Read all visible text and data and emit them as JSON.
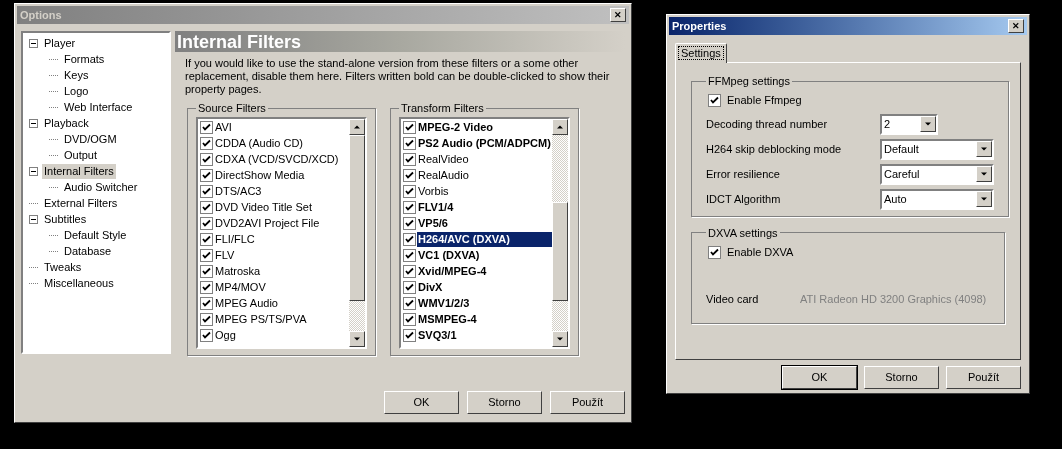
{
  "options_window": {
    "title": "Options",
    "close": "✕",
    "tree": [
      {
        "label": "Player",
        "expanded": true,
        "selected": false,
        "children": [
          {
            "label": "Formats",
            "selected": false
          },
          {
            "label": "Keys",
            "selected": false
          },
          {
            "label": "Logo",
            "selected": false
          },
          {
            "label": "Web Interface",
            "selected": false
          }
        ]
      },
      {
        "label": "Playback",
        "expanded": true,
        "selected": false,
        "children": [
          {
            "label": "DVD/OGM",
            "selected": false
          },
          {
            "label": "Output",
            "selected": false
          }
        ]
      },
      {
        "label": "Internal Filters",
        "expanded": true,
        "selected": true,
        "children": [
          {
            "label": "Audio Switcher",
            "selected": false
          }
        ]
      },
      {
        "label": "External Filters",
        "selected": false
      },
      {
        "label": "Subtitles",
        "expanded": true,
        "selected": false,
        "children": [
          {
            "label": "Default Style",
            "selected": false
          },
          {
            "label": "Database",
            "selected": false
          }
        ]
      },
      {
        "label": "Tweaks",
        "selected": false
      },
      {
        "label": "Miscellaneous",
        "selected": false
      }
    ],
    "page_title": "Internal Filters",
    "description": "If you would like to use the stand-alone version from these filters or a some other replacement, disable them here. Filters written bold can be double-clicked to show their property pages.",
    "groups": [
      {
        "title": "Source Filters",
        "items": [
          {
            "label": "AVI",
            "checked": true,
            "bold": false,
            "selected": false
          },
          {
            "label": "CDDA (Audio CD)",
            "checked": true,
            "bold": false,
            "selected": false
          },
          {
            "label": "CDXA (VCD/SVCD/XCD)",
            "checked": true,
            "bold": false,
            "selected": false
          },
          {
            "label": "DirectShow Media",
            "checked": true,
            "bold": false,
            "selected": false
          },
          {
            "label": "DTS/AC3",
            "checked": true,
            "bold": false,
            "selected": false
          },
          {
            "label": "DVD Video Title Set",
            "checked": true,
            "bold": false,
            "selected": false
          },
          {
            "label": "DVD2AVI Project File",
            "checked": true,
            "bold": false,
            "selected": false
          },
          {
            "label": "FLI/FLC",
            "checked": true,
            "bold": false,
            "selected": false
          },
          {
            "label": "FLV",
            "checked": true,
            "bold": false,
            "selected": false
          },
          {
            "label": "Matroska",
            "checked": true,
            "bold": false,
            "selected": false
          },
          {
            "label": "MP4/MOV",
            "checked": true,
            "bold": false,
            "selected": false
          },
          {
            "label": "MPEG Audio",
            "checked": true,
            "bold": false,
            "selected": false
          },
          {
            "label": "MPEG PS/TS/PVA",
            "checked": true,
            "bold": false,
            "selected": false
          },
          {
            "label": "Ogg",
            "checked": true,
            "bold": false,
            "selected": false
          }
        ]
      },
      {
        "title": "Transform Filters",
        "items": [
          {
            "label": "MPEG-2 Video",
            "checked": true,
            "bold": true,
            "selected": false
          },
          {
            "label": "PS2 Audio (PCM/ADPCM)",
            "checked": true,
            "bold": true,
            "selected": false
          },
          {
            "label": "RealVideo",
            "checked": true,
            "bold": false,
            "selected": false
          },
          {
            "label": "RealAudio",
            "checked": true,
            "bold": false,
            "selected": false
          },
          {
            "label": "Vorbis",
            "checked": true,
            "bold": false,
            "selected": false
          },
          {
            "label": "FLV1/4",
            "checked": true,
            "bold": true,
            "selected": false
          },
          {
            "label": "VP5/6",
            "checked": true,
            "bold": true,
            "selected": false
          },
          {
            "label": "H264/AVC (DXVA)",
            "checked": true,
            "bold": true,
            "selected": true
          },
          {
            "label": "VC1 (DXVA)",
            "checked": true,
            "bold": true,
            "selected": false
          },
          {
            "label": "Xvid/MPEG-4",
            "checked": true,
            "bold": true,
            "selected": false
          },
          {
            "label": "DivX",
            "checked": true,
            "bold": true,
            "selected": false
          },
          {
            "label": "WMV1/2/3",
            "checked": true,
            "bold": true,
            "selected": false
          },
          {
            "label": "MSMPEG-4",
            "checked": true,
            "bold": true,
            "selected": false
          },
          {
            "label": "SVQ3/1",
            "checked": true,
            "bold": true,
            "selected": false
          }
        ]
      }
    ],
    "buttons": [
      "OK",
      "Storno",
      "Použít"
    ]
  },
  "properties_window": {
    "title": "Properties",
    "close": "✕",
    "tabs": [
      {
        "label": "Settings",
        "selected": true
      }
    ],
    "ffmpeg_group": {
      "title": "FFMpeg settings",
      "enable": {
        "label": "Enable Ffmpeg",
        "checked": true
      },
      "rows": [
        {
          "label": "Decoding thread number",
          "value": "2",
          "kind": "short"
        },
        {
          "label": "H264 skip deblocking mode",
          "value": "Default",
          "kind": "wide"
        },
        {
          "label": "Error resilience",
          "value": "Careful",
          "kind": "wide"
        },
        {
          "label": "IDCT Algorithm",
          "value": "Auto",
          "kind": "wide"
        }
      ]
    },
    "dxva_group": {
      "title": "DXVA settings",
      "enable": {
        "label": "Enable DXVA",
        "checked": true
      },
      "video_card_label": "Video card",
      "video_card": "ATI Radeon HD 3200 Graphics (4098)"
    },
    "buttons": [
      {
        "label": "OK",
        "default": true
      },
      {
        "label": "Storno",
        "default": false
      },
      {
        "label": "Použít",
        "default": false
      }
    ]
  }
}
